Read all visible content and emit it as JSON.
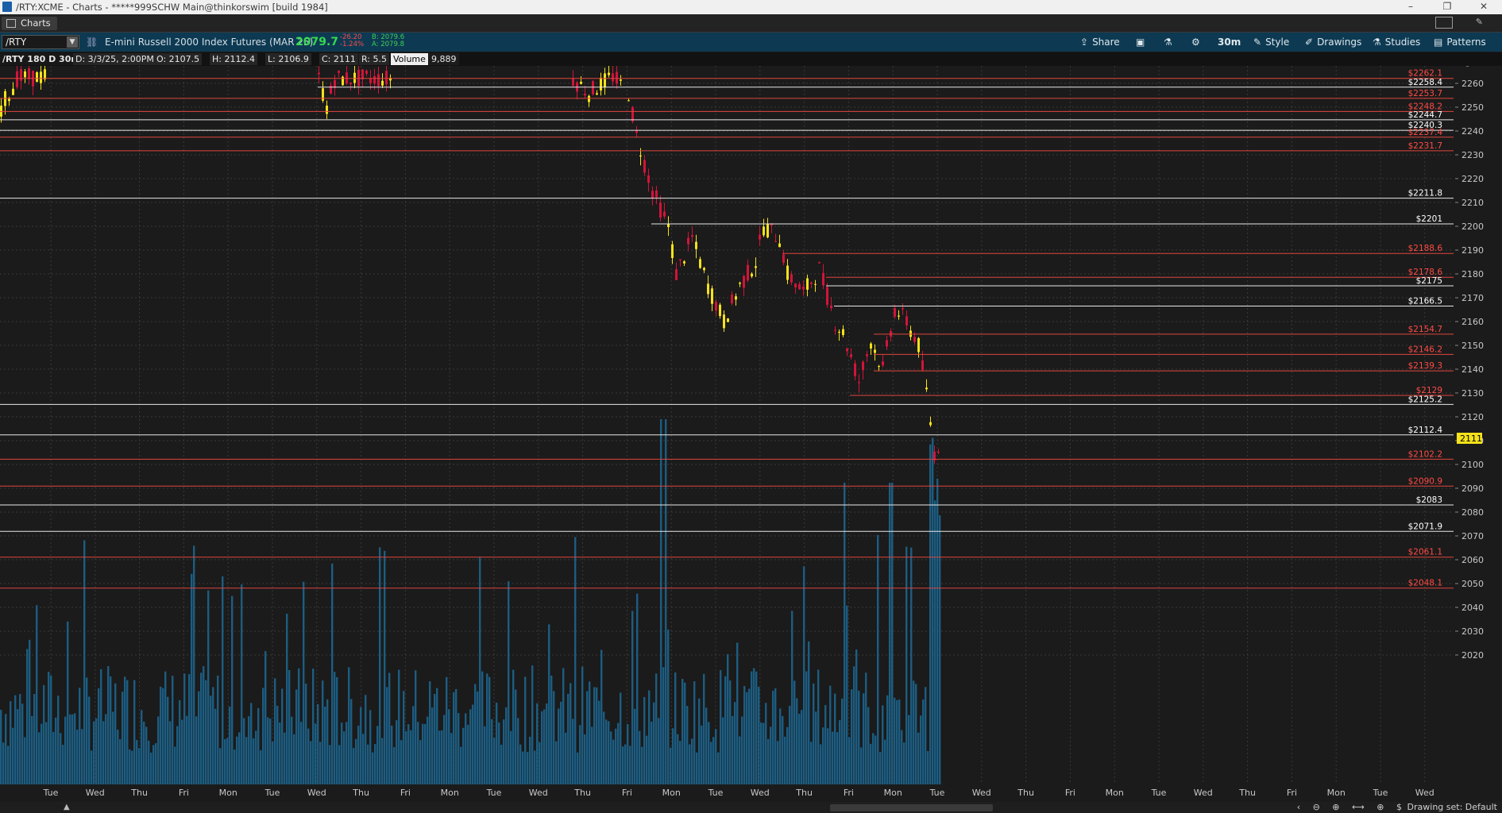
{
  "window": {
    "title": "/RTY:XCME - Charts - *****999SCHW Main@thinkorswim [build 1984]",
    "minimize": "–",
    "maximize": "❐",
    "close": "✕"
  },
  "tabs": [
    {
      "label": "Charts"
    }
  ],
  "toolbar": {
    "symbol": "/RTY",
    "instrument": "E-mini Russell 2000 Index Futures (MAR 25)",
    "last": "2079.7",
    "net_change": "-26.20",
    "pct_change": "-1.24%",
    "bid": "B: 2079.6",
    "ask": "A: 2079.8",
    "buttons": {
      "share": "Share",
      "timeframe": "30m",
      "style": "Style",
      "drawings": "Drawings",
      "studies": "Studies",
      "patterns": "Patterns"
    },
    "icons": {
      "share": "share-icon",
      "snapshot": "snapshot-icon",
      "flask": "flask-icon",
      "settings": "gear-icon",
      "style": "style-icon",
      "drawings": "drawings-icon",
      "studies": "studies-icon",
      "patterns": "patterns-icon"
    }
  },
  "info": {
    "symbol_period": "/RTY 180 D 30m",
    "date": "D: 3/3/25, 2:00PM",
    "open": "O: 2107.5",
    "high": "H: 2112.4",
    "low": "L: 2106.9",
    "close": "C: 2111",
    "range": "R: 5.5",
    "volume_label": "Volume",
    "volume_value": "9,889"
  },
  "chart_data": {
    "type": "candlestick",
    "colors": {
      "up": "#f5e21a",
      "down": "#d2143a",
      "volume": "#1c5d82",
      "support": "#e8e8e8",
      "resistance": "#e0463e"
    },
    "y_ticks": [
      2260,
      2250,
      2240,
      2230,
      2220,
      2210,
      2200,
      2190,
      2180,
      2170,
      2160,
      2150,
      2140,
      2130,
      2120,
      2110,
      2100,
      2090,
      2080,
      2070,
      2060,
      2050,
      2040,
      2030,
      2020
    ],
    "x_labels": [
      "Tue",
      "Wed",
      "Thu",
      "Fri",
      "Mon",
      "Tue",
      "Wed",
      "Thu",
      "Fri",
      "Mon",
      "Tue",
      "Wed",
      "Thu",
      "Fri",
      "Mon",
      "Tue",
      "Wed",
      "Thu",
      "Fri",
      "Mon",
      "Tue",
      "Wed",
      "Thu",
      "Fri",
      "Mon",
      "Tue",
      "Wed",
      "Thu",
      "Fri",
      "Mon",
      "Tue",
      "Wed"
    ],
    "price_lines": [
      {
        "label": "$2262.1",
        "value": 2262.1,
        "color": "red"
      },
      {
        "label": "$2258.4",
        "value": 2258.4,
        "color": "white"
      },
      {
        "label": "$2253.7",
        "value": 2253.7,
        "color": "red"
      },
      {
        "label": "$2248.2",
        "value": 2248.2,
        "color": "red"
      },
      {
        "label": "$2244.7",
        "value": 2244.7,
        "color": "white"
      },
      {
        "label": "$2240.3",
        "value": 2240.3,
        "color": "white"
      },
      {
        "label": "$2237.4",
        "value": 2237.4,
        "color": "red"
      },
      {
        "label": "$2231.7",
        "value": 2231.7,
        "color": "red"
      },
      {
        "label": "$2211.8",
        "value": 2211.8,
        "color": "white"
      },
      {
        "label": "$2201",
        "value": 2201,
        "color": "white"
      },
      {
        "label": "$2188.6",
        "value": 2188.6,
        "color": "red"
      },
      {
        "label": "$2178.6",
        "value": 2178.6,
        "color": "red"
      },
      {
        "label": "$2175",
        "value": 2175,
        "color": "white"
      },
      {
        "label": "$2166.5",
        "value": 2166.5,
        "color": "white"
      },
      {
        "label": "$2154.7",
        "value": 2154.7,
        "color": "red"
      },
      {
        "label": "$2146.2",
        "value": 2146.2,
        "color": "red"
      },
      {
        "label": "$2139.3",
        "value": 2139.3,
        "color": "red"
      },
      {
        "label": "$2129",
        "value": 2129,
        "color": "red"
      },
      {
        "label": "$2125.2",
        "value": 2125.2,
        "color": "white"
      },
      {
        "label": "$2112.4",
        "value": 2112.4,
        "color": "white"
      },
      {
        "label": "$2102.2",
        "value": 2102.2,
        "color": "red"
      },
      {
        "label": "$2090.9",
        "value": 2090.9,
        "color": "red"
      },
      {
        "label": "$2083",
        "value": 2083,
        "color": "white"
      },
      {
        "label": "$2071.9",
        "value": 2071.9,
        "color": "white"
      },
      {
        "label": "$2061.1",
        "value": 2061.1,
        "color": "red"
      },
      {
        "label": "$2048.1",
        "value": 2048.1,
        "color": "red"
      }
    ],
    "current_price_label": "2111",
    "current_price": 2111,
    "grid": true
  },
  "status": {
    "drawing_set": "Drawing set: Default",
    "zoom_controls": "‹ ⊖ ⊕ ⟷ ⊕ $"
  }
}
